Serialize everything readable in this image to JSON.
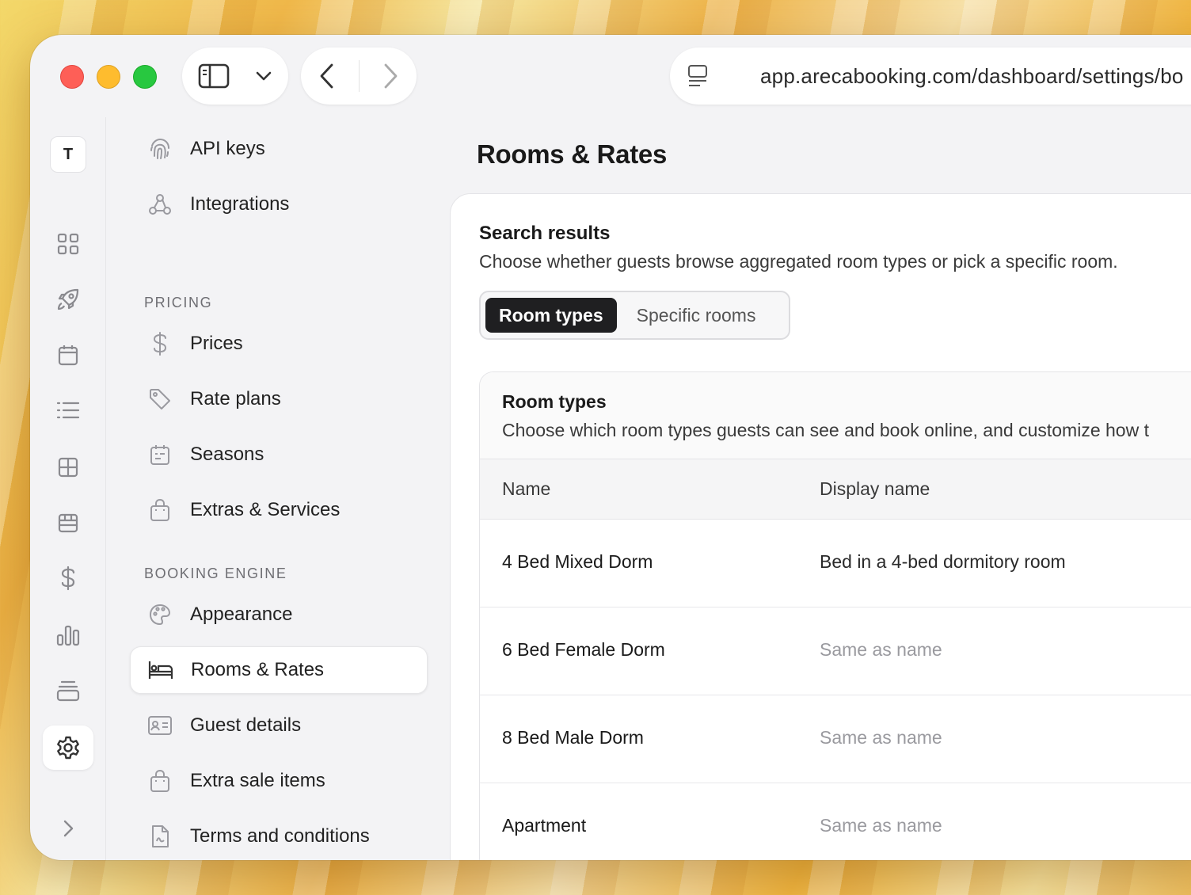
{
  "browser": {
    "url": "app.arecabooking.com/dashboard/settings/bo"
  },
  "rail": {
    "avatar_letter": "T",
    "icons": [
      "grid-icon",
      "rocket-icon",
      "calendar-icon",
      "list-icon",
      "layout-icon",
      "storefront-icon",
      "dollar-icon",
      "bar-chart-icon",
      "stack-icon",
      "gear-icon",
      "chevron-right-icon"
    ]
  },
  "nav": {
    "items_top": [
      {
        "label": "API keys",
        "icon": "fingerprint-icon"
      },
      {
        "label": "Integrations",
        "icon": "webhook-icon"
      }
    ],
    "section_pricing": "PRICING",
    "pricing_items": [
      {
        "label": "Prices",
        "icon": "dollar-icon"
      },
      {
        "label": "Rate plans",
        "icon": "tag-icon"
      },
      {
        "label": "Seasons",
        "icon": "calendar-icon"
      },
      {
        "label": "Extras & Services",
        "icon": "bag-icon"
      }
    ],
    "section_booking": "BOOKING ENGINE",
    "booking_items": [
      {
        "label": "Appearance",
        "icon": "palette-icon"
      },
      {
        "label": "Rooms & Rates",
        "icon": "bed-icon"
      },
      {
        "label": "Guest details",
        "icon": "id-card-icon"
      },
      {
        "label": "Extra sale items",
        "icon": "bag-icon"
      },
      {
        "label": "Terms and conditions",
        "icon": "document-icon"
      }
    ]
  },
  "main": {
    "title": "Rooms & Rates",
    "search_results": {
      "title": "Search results",
      "description": "Choose whether guests browse aggregated room types or pick a specific room.",
      "options": [
        "Room types",
        "Specific rooms"
      ],
      "selected": "Room types"
    },
    "room_types": {
      "title": "Room types",
      "description": "Choose which room types guests can see and book online, and customize how t",
      "columns": [
        "Name",
        "Display name"
      ],
      "rows": [
        {
          "name": "4 Bed Mixed Dorm",
          "display_name": "Bed in a 4-bed dormitory room",
          "is_placeholder": false
        },
        {
          "name": "6 Bed Female Dorm",
          "display_name": "Same as name",
          "is_placeholder": true
        },
        {
          "name": "8 Bed Male Dorm",
          "display_name": "Same as name",
          "is_placeholder": true
        },
        {
          "name": "Apartment",
          "display_name": "Same as name",
          "is_placeholder": true
        }
      ]
    }
  }
}
